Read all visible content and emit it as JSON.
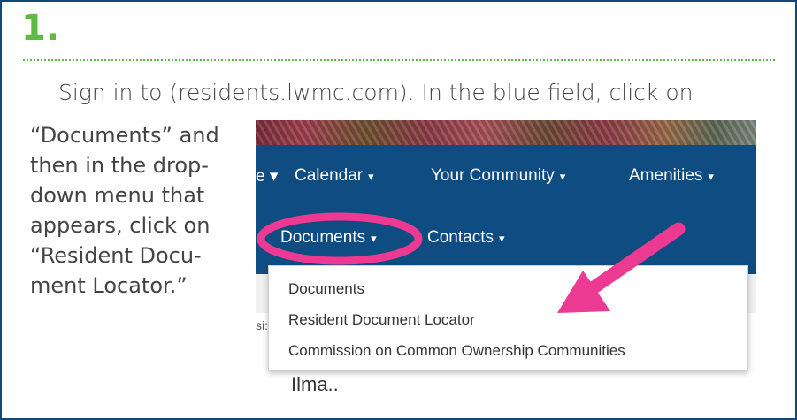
{
  "step": {
    "number": "1."
  },
  "instructions": {
    "intro": "Sign in to (residents.lwmc.com). In the blue field, click on",
    "side_lines": [
      "“Documents” and",
      "then in the drop-",
      "down menu that",
      "appears, click on",
      "“Resident Docu-",
      "ment Locator.”"
    ]
  },
  "screenshot": {
    "nav": {
      "partial_caret": "e ▾",
      "row1": [
        "Calendar",
        "Your Community",
        "Amenities"
      ],
      "row2": [
        "Documents",
        "Contacts"
      ]
    },
    "dropdown": {
      "items": [
        "Documents",
        "Resident Document Locator",
        "Commission on Common Ownership Communities"
      ]
    },
    "fragments": {
      "left_edge": "si:",
      "below_menu": "Ilma.."
    }
  },
  "colors": {
    "brand_green": "#5dbb46",
    "nav_blue": "#0f4c81",
    "highlight_pink": "#ec3a92",
    "border_blue": "#0e4977"
  },
  "annotations": {
    "circle_target": "Documents",
    "arrow_target": "Resident Document Locator",
    "icon": "arrow-icon"
  }
}
